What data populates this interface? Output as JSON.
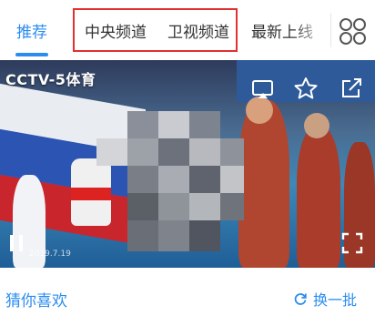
{
  "tabs": [
    {
      "label": "推荐",
      "active": true
    },
    {
      "label": "中央频道",
      "active": false
    },
    {
      "label": "卫视频道",
      "active": false
    },
    {
      "label": "最新上线",
      "active": false
    }
  ],
  "colors": {
    "accent": "#2a8cf0",
    "highlight_box": "#e03030"
  },
  "player": {
    "channel_title": "CCTV-5体育",
    "date": "2019.7.19",
    "icons": [
      "cast-icon",
      "favorite-star-icon",
      "share-icon",
      "pause-icon",
      "fullscreen-icon"
    ]
  },
  "recommend": {
    "title": "猜你喜欢",
    "refresh_label": "换一批"
  }
}
